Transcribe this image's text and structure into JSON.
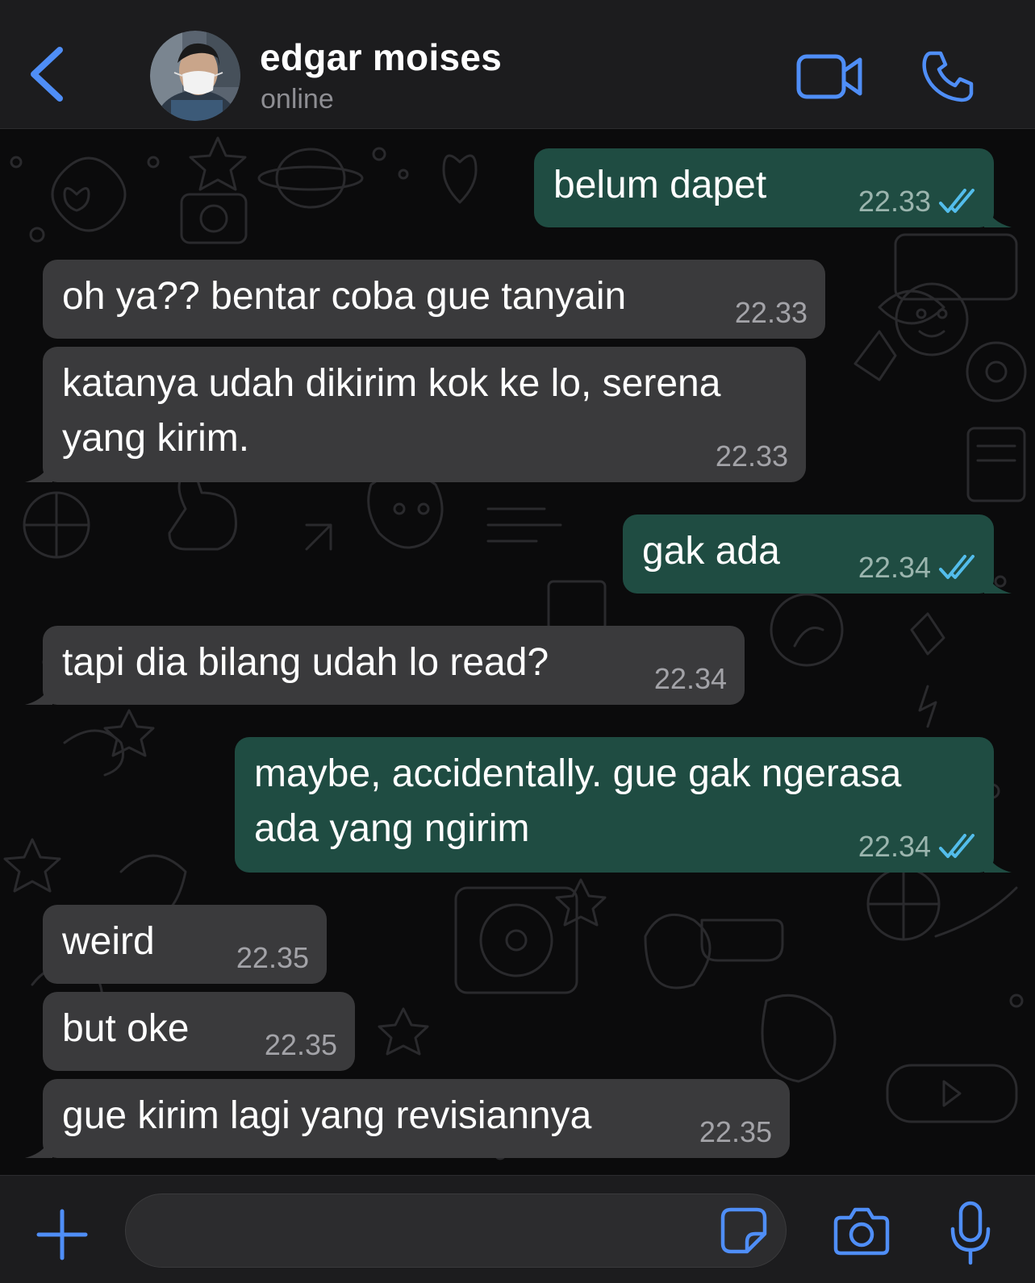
{
  "colors": {
    "accent": "#4f8ef7",
    "incoming_bubble": "#3a3a3c",
    "outgoing_bubble": "#1f4c42",
    "read_ticks": "#53bdeb",
    "header_bg": "#1c1c1e"
  },
  "header": {
    "back_icon": "chevron-left-icon",
    "contact_name": "edgar moises",
    "status": "online",
    "video_icon": "video-camera-icon",
    "call_icon": "phone-icon"
  },
  "messages": [
    {
      "direction": "out",
      "text": "belum dapet",
      "time": "22.33",
      "status": "read",
      "tail": true
    },
    {
      "direction": "in",
      "text": "oh ya?? bentar coba gue tanyain",
      "time": "22.33",
      "tail": false
    },
    {
      "direction": "in",
      "text": "katanya udah dikirim kok ke lo, serena\nyang kirim.",
      "time": "22.33",
      "tail": true
    },
    {
      "direction": "out",
      "text": "gak ada",
      "time": "22.34",
      "status": "read",
      "tail": true
    },
    {
      "direction": "in",
      "text": "tapi dia bilang udah lo read?",
      "time": "22.34",
      "tail": true
    },
    {
      "direction": "out",
      "text": "maybe, accidentally. gue gak ngerasa\nada yang ngirim",
      "time": "22.34",
      "status": "read",
      "tail": true
    },
    {
      "direction": "in",
      "text": "weird",
      "time": "22.35",
      "tail": false
    },
    {
      "direction": "in",
      "text": "but oke",
      "time": "22.35",
      "tail": false
    },
    {
      "direction": "in",
      "text": "gue kirim lagi yang revisiannya",
      "time": "22.35",
      "tail": true
    }
  ],
  "composer": {
    "plus_icon": "plus-icon",
    "input_value": "",
    "input_placeholder": "",
    "sticker_icon": "sticker-icon",
    "camera_icon": "camera-icon",
    "mic_icon": "microphone-icon"
  }
}
